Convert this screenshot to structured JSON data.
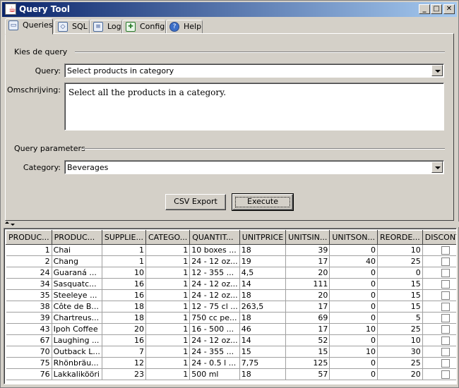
{
  "window": {
    "title": "Query Tool",
    "buttons": {
      "minimize": "_",
      "maximize": "□",
      "close": "✕"
    }
  },
  "tabs": [
    {
      "label": "Queries",
      "icon": "queries-icon",
      "active": true
    },
    {
      "label": "SQL",
      "icon": "sql-icon"
    },
    {
      "label": "Log",
      "icon": "log-icon"
    },
    {
      "label": "Config",
      "icon": "config-icon"
    },
    {
      "label": "Help",
      "icon": "help-icon"
    }
  ],
  "query_section": {
    "title": "Kies de query",
    "query_label": "Query:",
    "query_value": "Select products in category",
    "description_label": "Omschrijving:",
    "description_value": "Select all the products in a category."
  },
  "params_section": {
    "title": "Query parameters",
    "category_label": "Category:",
    "category_value": "Beverages"
  },
  "actions": {
    "csv_export": "CSV Export",
    "execute": "Execute"
  },
  "table": {
    "columns": [
      "PRODUC...",
      "PRODUC...",
      "SUPPLIE...",
      "CATEGO...",
      "QUANTIT...",
      "UNITPRICE",
      "UNITSIN...",
      "UNITSON...",
      "REORDE...",
      "DISCONT..."
    ],
    "rows": [
      [
        "1",
        "Chai",
        "1",
        "1",
        "10 boxes ...",
        "18",
        "39",
        "0",
        "10"
      ],
      [
        "2",
        "Chang",
        "1",
        "1",
        "24 - 12 oz...",
        "19",
        "17",
        "40",
        "25"
      ],
      [
        "24",
        "Guaraná ...",
        "10",
        "1",
        "12 - 355 ...",
        "4,5",
        "20",
        "0",
        "0"
      ],
      [
        "34",
        "Sasquatc...",
        "16",
        "1",
        "24 - 12 oz...",
        "14",
        "111",
        "0",
        "15"
      ],
      [
        "35",
        "Steeleye ...",
        "16",
        "1",
        "24 - 12 oz...",
        "18",
        "20",
        "0",
        "15"
      ],
      [
        "38",
        "Côte de B...",
        "18",
        "1",
        "12 - 75 cl ...",
        "263,5",
        "17",
        "0",
        "15"
      ],
      [
        "39",
        "Chartreus...",
        "18",
        "1",
        "750 cc pe...",
        "18",
        "69",
        "0",
        "5"
      ],
      [
        "43",
        "Ipoh Coffee",
        "20",
        "1",
        "16 - 500 ...",
        "46",
        "17",
        "10",
        "25"
      ],
      [
        "67",
        "Laughing ...",
        "16",
        "1",
        "24 - 12 oz...",
        "14",
        "52",
        "0",
        "10"
      ],
      [
        "70",
        "Outback L...",
        "7",
        "1",
        "24 - 355 ...",
        "15",
        "15",
        "10",
        "30"
      ],
      [
        "75",
        "Rhönbräu...",
        "12",
        "1",
        "24 - 0.5 l ...",
        "7,75",
        "125",
        "0",
        "25"
      ],
      [
        "76",
        "Lakkalikööri",
        "23",
        "1",
        "500 ml",
        "18",
        "57",
        "0",
        "20"
      ]
    ]
  }
}
